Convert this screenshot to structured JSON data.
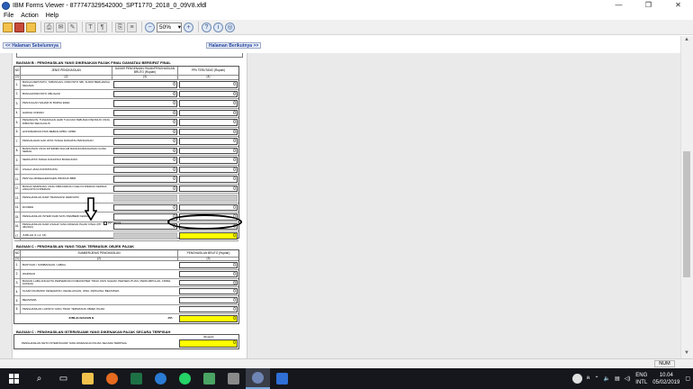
{
  "window": {
    "title": "IBM Forms Viewer - 877747329542000_SPT1770_2018_0_09V8.xfdl",
    "controls": [
      "—",
      "❐",
      "✕"
    ]
  },
  "menu": [
    "File",
    "Action",
    "Help"
  ],
  "toolbar": {
    "zoom": "50%"
  },
  "nav": {
    "prev": "<< Halaman Sebelumnya",
    "next": "Halaman Berikutnya >>"
  },
  "sectionB": {
    "title": "BAGIAN B :   PENGHASILAN YANG DIKENAKAN PAJAK FINAL DAN/ATAU BERSIFAT FINAL",
    "col_no": "NO",
    "col_desc": "JENIS PENGHASILAN",
    "col_dpp": "DASAR PENGENAAN PAJAK/PENGHASILAN BRUTO (Rupiah)",
    "col_pph": "PPh TERUTANG (Rupiah)",
    "col_idx": [
      "(1)",
      "(2)",
      "(3)",
      "(4)"
    ],
    "rows": [
      {
        "no": "1.",
        "label": "BUNGA DEPOSITO, TABUNGAN, DISKONTO SBI, SURAT BERHARGA NEGARA",
        "dpp": "0",
        "pph": "0"
      },
      {
        "no": "2.",
        "label": "BUNGA/DISKONTO OBLIGASI",
        "dpp": "0",
        "pph": "0"
      },
      {
        "no": "3.",
        "label": "PENJUALAN SAHAM DI BURSA EFEK",
        "dpp": "0",
        "pph": "0"
      },
      {
        "no": "4.",
        "label": "HADIAH UNDIAN",
        "dpp": "0",
        "pph": "0"
      },
      {
        "no": "5.",
        "label": "PESANGON, TUNJANGAN HARI TUA DAN TEBUSAN PENSIUN YANG DIBAYAR SEKALIGUS",
        "dpp": "0",
        "pph": "0"
      },
      {
        "no": "6.",
        "label": "HONORARIUM ATAS BEBAN APBN / APBD",
        "dpp": "0",
        "pph": "0"
      },
      {
        "no": "7.",
        "label": "PENGALIHAN HAK ATAS TANAH DAN/ATAU BANGUNAN",
        "dpp": "0",
        "pph": "0"
      },
      {
        "no": "8.",
        "label": "BANGUNAN YANG DITERIMA DALAM RANGKA BANGUNAN GUNA SERAH",
        "dpp": "0",
        "pph": "0"
      },
      {
        "no": "9.",
        "label": "SEWA ATAS TANAH DAN/ATAU BANGUNAN",
        "dpp": "0",
        "pph": "0"
      },
      {
        "no": "10.",
        "label": "USAHA JASA KONSTRUKSI",
        "dpp": "0",
        "pph": "0"
      },
      {
        "no": "11.",
        "label": "PENYALUR/DEALER/AGEN PRODUK BBM",
        "dpp": "0",
        "pph": "0"
      },
      {
        "no": "12.",
        "label": "BUNGA SIMPANAN YANG DIBAYARKAN OLEH KOPERASI KEPADA ANGGOTA KOPERASI",
        "dpp": "0",
        "pph": "0"
      },
      {
        "no": "13.",
        "label": "PENGHASILAN DARI TRANSAKSI DERIVATIF",
        "dpp": "",
        "pph": ""
      },
      {
        "no": "14.",
        "label": "DIVIDEN",
        "dpp": "0",
        "pph": "0"
      },
      {
        "no": "15.",
        "label": "PENGHASILAN ISTERI DARI SATU PEMBERI KERJA",
        "dpp": "0",
        "pph": "0"
      },
      {
        "no": "16.",
        "label": "PENGHASILAN DARI USAHA YANG DIKENAI PAJAK FINAL (PP 46/2013)",
        "dpp": "0",
        "pph": "0"
      },
      {
        "no": "17.",
        "label": "JUMLAH (1 s.d. 16)",
        "dpp": "",
        "pph": "0"
      }
    ],
    "pp_checkbox": "PP 46/23"
  },
  "sectionC": {
    "title": "BAGIAN C :   PENGHASILAN YANG TIDAK TERMASUK OBJEK PAJAK",
    "col_no": "NO",
    "col_desc": "SUMBER/JENIS PENGHASILAN",
    "col_val": "PENGHASILAN BRUTO (Rupiah)",
    "col_idx": [
      "(1)",
      "(2)",
      "(3)"
    ],
    "rows": [
      {
        "no": "1.",
        "label": "BANTUAN / SUMBANGAN / HIBAH",
        "val": "0"
      },
      {
        "no": "2.",
        "label": "WARISAN",
        "val": "0"
      },
      {
        "no": "3.",
        "label": "BAGIAN LABA ANGGOTA PERSEROAN KOMANDITER TIDAK ATAS SAHAM, PERSEKUTUAN, PERKUMPULAN, FIRMA, KONGSI",
        "val": "0"
      },
      {
        "no": "4.",
        "label": "KLAIM ASURANSI KESEHATAN, KECELAKAAN, JIWA, DWIGUNA, BEASISWA",
        "val": "0"
      },
      {
        "no": "5.",
        "label": "BEASISWA",
        "val": "0"
      },
      {
        "no": "6.",
        "label": "PENGHASILAN LAINNYA YANG TIDAK TERMASUK OBJEK PAJAK",
        "val": "0"
      }
    ],
    "total_label": "JUMLAH BAGIAN B",
    "total_tag": "JBB",
    "total_val": "0"
  },
  "sectionD": {
    "title": "BAGIAN C :   PENGHASILAN ISTERI/SUAMI YANG DIKENAKAN PAJAK SECARA TERPISAH",
    "col_val": "(Rupiah)",
    "label": "PENGHASILAN NETO ISTERI/SUAMI YANG DIKENAKAN PAJAK SECARA TERPISAH",
    "val": "0"
  },
  "status": {
    "num": "NUM"
  },
  "tray": {
    "lang1": "ENG",
    "lang2": "INTL",
    "time": "10.04",
    "date": "05/02/2019"
  },
  "colors": {
    "highlight": "#ffff00",
    "readonly": "#c9c9c9",
    "taskbar": "#15171c"
  }
}
